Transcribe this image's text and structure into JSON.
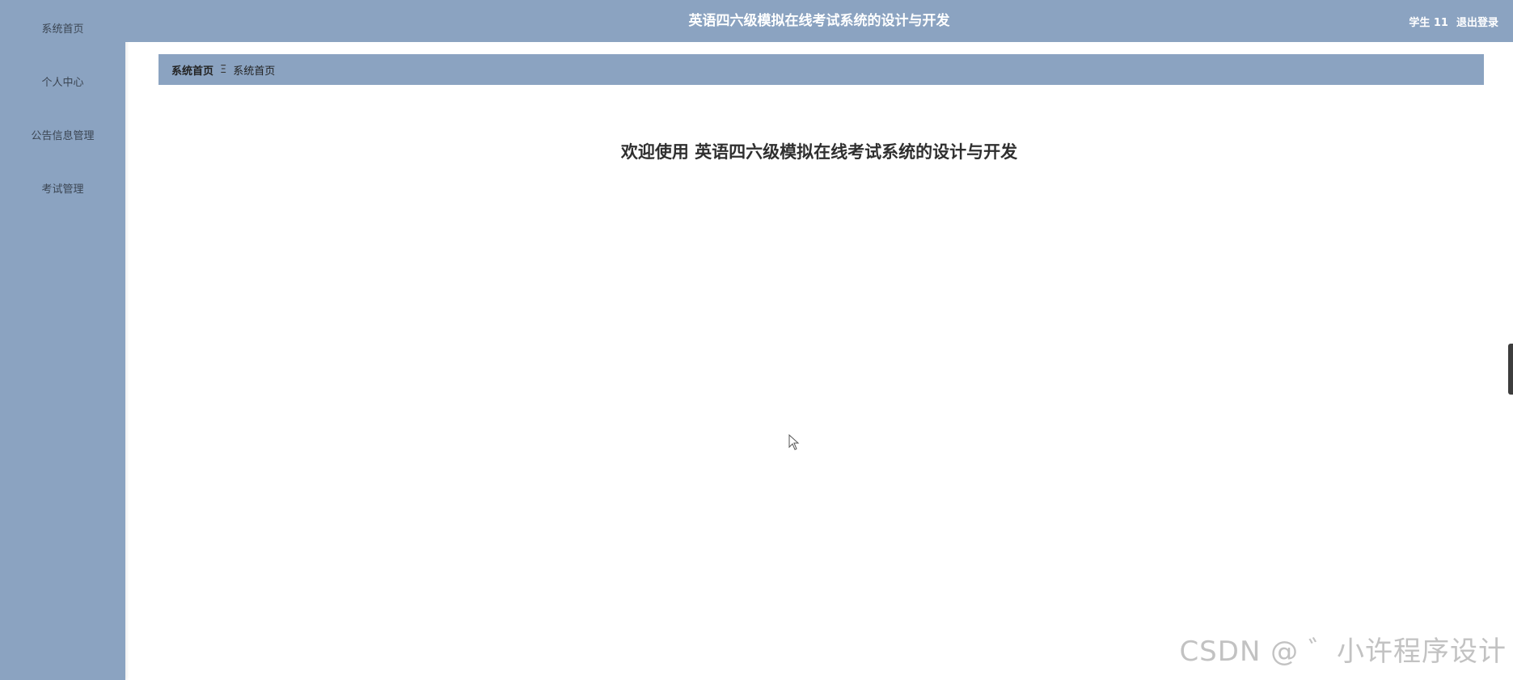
{
  "sidebar": {
    "items": [
      {
        "label": "系统首页"
      },
      {
        "label": "个人中心"
      },
      {
        "label": "公告信息管理"
      },
      {
        "label": "考试管理"
      }
    ]
  },
  "header": {
    "title": "英语四六级模拟在线考试系统的设计与开发",
    "user": "学生 11",
    "logout_label": "退出登录"
  },
  "breadcrumb": {
    "home": "系统首页",
    "separator": "Ξ",
    "current": "系统首页"
  },
  "main": {
    "welcome": "欢迎使用 英语四六级模拟在线考试系统的设计与开发"
  },
  "watermark": {
    "text": "CSDN @ ゛小许程序设计"
  },
  "colors": {
    "sidebar_bg": "#8ba3c1",
    "header_bg": "#8ba3c1"
  },
  "icons": {
    "cursor": "mouse-cursor-icon"
  }
}
